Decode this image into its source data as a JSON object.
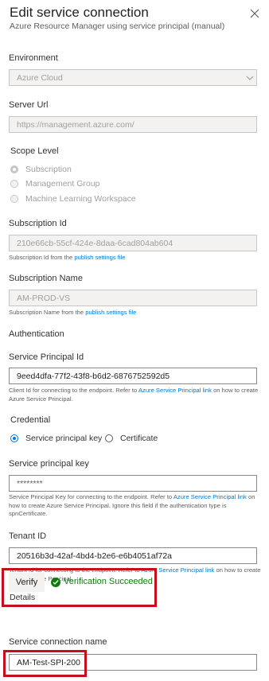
{
  "header": {
    "title": "Edit service connection",
    "subtitle": "Azure Resource Manager using service principal (manual)"
  },
  "environment": {
    "label": "Environment",
    "value": "Azure Cloud"
  },
  "server_url": {
    "label": "Server Url",
    "value": "https://management.azure.com/"
  },
  "scope_level": {
    "label": "Scope Level",
    "options": [
      "Subscription",
      "Management Group",
      "Machine Learning Workspace"
    ],
    "selected": "Subscription"
  },
  "subscription_id": {
    "label": "Subscription Id",
    "value": "210e66cb-55cf-424e-8daa-6cad804ab604",
    "help_prefix": "Subscription Id from the ",
    "help_link": "publish settings file"
  },
  "subscription_name": {
    "label": "Subscription Name",
    "value": "AM-PROD-VS",
    "help_prefix": "Subscription Name from the ",
    "help_link": "publish settings file"
  },
  "authentication": {
    "heading": "Authentication"
  },
  "service_principal_id": {
    "label": "Service Principal Id",
    "value": "9eed4dfa-77f2-43f8-b6d2-6876752592d5",
    "help_prefix": "Client Id for connecting to the endpoint. Refer to ",
    "help_link": "Azure Service Principal link",
    "help_suffix": " on how to create Azure Service Principal."
  },
  "credential": {
    "label": "Credential",
    "options": [
      "Service principal key",
      "Certificate"
    ],
    "selected": "Service principal key"
  },
  "service_principal_key": {
    "label": "Service principal key",
    "value": "********",
    "help_prefix": "Service Principal Key for connecting to the endpoint. Refer to ",
    "help_link": "Azure Service Principal link",
    "help_suffix": " on how to create Azure Service Principal. Ignore this field if the authentication type is spnCertificate."
  },
  "tenant_id": {
    "label": "Tenant ID",
    "value": "20516b3d-42af-4bd4-b2e6-e6b4051af72a",
    "help_prefix": "Tenant Id for connecting to the endpoint. Refer to ",
    "help_link": "Azure Service Principal link",
    "help_suffix": " on how to create Azure Service Principal."
  },
  "verify": {
    "button_label": "Verify",
    "status": "Verification Succeeded",
    "details_label": "Details"
  },
  "connection_name": {
    "label": "Service connection name",
    "value": "AM-Test-SPI-200"
  },
  "colors": {
    "accent": "#0078d4",
    "success": "#107c10",
    "highlight": "#c50f1f"
  }
}
